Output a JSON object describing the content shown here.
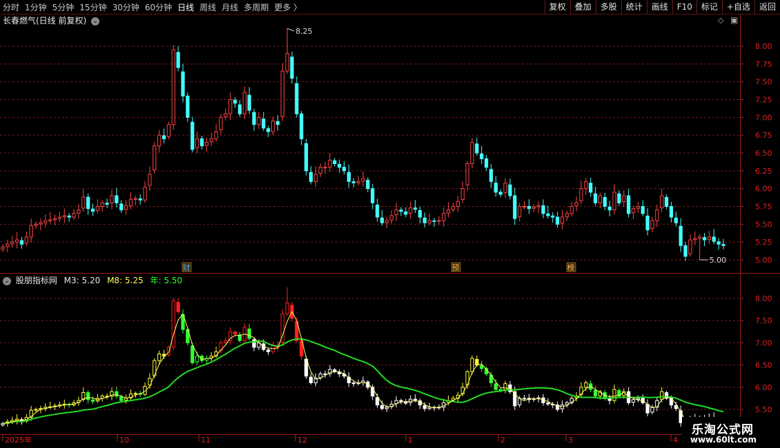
{
  "toolbar": {
    "periods": [
      {
        "label": "分时",
        "active": false
      },
      {
        "label": "1分钟",
        "active": false
      },
      {
        "label": "5分钟",
        "active": false
      },
      {
        "label": "15分钟",
        "active": false
      },
      {
        "label": "30分钟",
        "active": false
      },
      {
        "label": "60分钟",
        "active": false
      },
      {
        "label": "日线",
        "active": true
      },
      {
        "label": "周线",
        "active": false
      },
      {
        "label": "月线",
        "active": false
      },
      {
        "label": "多周期",
        "active": false
      },
      {
        "label": "更多",
        "active": false
      }
    ],
    "more_arrow": "〉",
    "right_buttons": [
      "复权",
      "叠加",
      "多股",
      "统计",
      "画线",
      "F10",
      "标记",
      "+自选",
      "返回"
    ]
  },
  "main_panel": {
    "title": "长春燃气(日线 前复权)",
    "high_label": "8.25",
    "low_label": "5.00",
    "price_ticks": [
      "8.00",
      "7.75",
      "7.50",
      "7.25",
      "7.00",
      "6.75",
      "6.50",
      "6.25",
      "6.00",
      "5.75",
      "5.50",
      "5.25",
      "5.00"
    ],
    "markers": [
      "财",
      "预",
      "预",
      "财"
    ],
    "markers_visible": [
      "财",
      "预",
      "榜"
    ]
  },
  "indicator_panel": {
    "name": "股朋指标网",
    "m3_label": "M3: 5.20",
    "m8_label": "M8: 5.25",
    "year_label": "年: 5.50",
    "price_ticks": [
      "8.00",
      "7.50",
      "7.00",
      "6.50",
      "6.00",
      "5.50"
    ]
  },
  "date_axis": [
    "2025年",
    "10",
    "11",
    "12",
    "1",
    "2",
    "3",
    "4"
  ],
  "watermark": {
    "line1": "乐淘公式网",
    "line2": "www.60lt.com"
  },
  "colors": {
    "up": "#ff4444",
    "down": "#44ffff",
    "grid": "#7a1a1a",
    "yellow": "#ffff33",
    "red_bar": "#ff2020",
    "green_bar": "#33ff33",
    "white_bar": "#ffffff",
    "ma_line": "#22dd22",
    "ma3_line": "#ffff66"
  },
  "chart_data": {
    "type": "candlestick",
    "title": "长春燃气(日线 前复权)",
    "ylim": [
      4.9,
      8.3
    ],
    "closes": [
      5.18,
      5.22,
      5.25,
      5.28,
      5.22,
      5.32,
      5.48,
      5.5,
      5.52,
      5.55,
      5.56,
      5.58,
      5.6,
      5.62,
      5.6,
      5.65,
      5.7,
      5.88,
      5.72,
      5.68,
      5.75,
      5.8,
      5.78,
      5.9,
      5.8,
      5.7,
      5.76,
      5.85,
      5.86,
      5.84,
      6.02,
      6.2,
      6.6,
      6.75,
      6.7,
      6.9,
      7.95,
      7.7,
      7.3,
      7.0,
      6.55,
      6.7,
      6.6,
      6.65,
      6.7,
      6.8,
      7.0,
      7.05,
      7.25,
      7.2,
      7.05,
      7.35,
      7.1,
      6.9,
      7.0,
      6.85,
      6.8,
      6.95,
      6.9,
      7.65,
      7.9,
      7.55,
      7.05,
      6.7,
      6.25,
      6.1,
      6.2,
      6.3,
      6.3,
      6.4,
      6.35,
      6.3,
      6.25,
      6.1,
      6.08,
      6.1,
      6.14,
      6.0,
      5.8,
      5.6,
      5.52,
      5.55,
      5.62,
      5.7,
      5.68,
      5.64,
      5.73,
      5.71,
      5.6,
      5.52,
      5.55,
      5.54,
      5.55,
      5.65,
      5.7,
      5.75,
      5.82,
      6.0,
      6.35,
      6.65,
      6.5,
      6.42,
      6.3,
      6.1,
      5.95,
      5.92,
      6.08,
      5.9,
      5.58,
      5.75,
      5.75,
      5.72,
      5.74,
      5.76,
      5.65,
      5.62,
      5.6,
      5.5,
      5.6,
      5.65,
      5.75,
      5.8,
      6.0,
      6.1,
      5.95,
      5.8,
      5.9,
      5.75,
      5.7,
      5.95,
      5.8,
      5.9,
      5.65,
      5.72,
      5.75,
      5.65,
      5.42,
      5.55,
      5.7,
      5.9,
      5.75,
      5.6,
      5.52,
      5.2,
      5.05,
      5.28,
      5.3,
      5.32,
      5.28,
      5.32,
      5.26,
      5.22,
      5.2
    ]
  }
}
